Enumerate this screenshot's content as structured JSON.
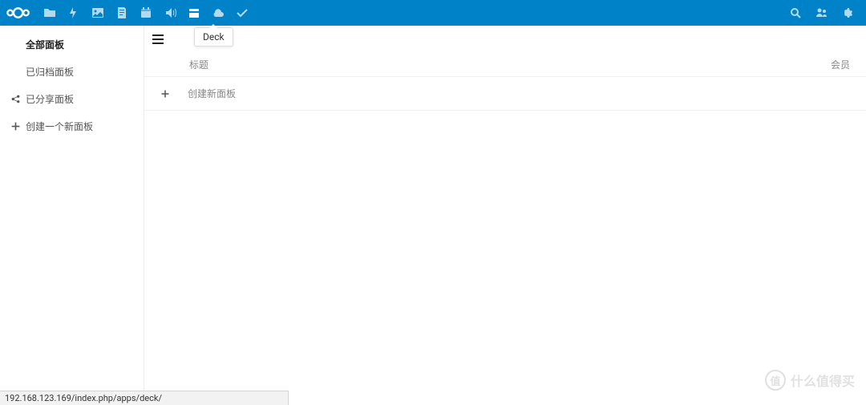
{
  "colors": {
    "brand": "#0082c9"
  },
  "tooltip": {
    "text": "Deck"
  },
  "topbar": {
    "apps": [
      {
        "name": "files-icon"
      },
      {
        "name": "activity-icon"
      },
      {
        "name": "gallery-icon"
      },
      {
        "name": "notes-icon"
      },
      {
        "name": "calendar-icon"
      },
      {
        "name": "audio-icon"
      },
      {
        "name": "deck-icon",
        "active": true
      },
      {
        "name": "cloud-icon"
      },
      {
        "name": "tasks-icon"
      }
    ],
    "right": [
      {
        "name": "search-icon"
      },
      {
        "name": "contacts-icon"
      },
      {
        "name": "settings-icon"
      }
    ]
  },
  "sidebar": {
    "items": [
      {
        "label": "全部面板",
        "name": "sidebar-item-all-boards",
        "active": true,
        "icon": null
      },
      {
        "label": "已归档面板",
        "name": "sidebar-item-archived",
        "icon": null
      },
      {
        "label": "已分享面板",
        "name": "sidebar-item-shared",
        "icon": "share"
      },
      {
        "label": "创建一个新面板",
        "name": "sidebar-item-create",
        "icon": "plus"
      }
    ]
  },
  "main": {
    "table": {
      "title_header": "标题",
      "member_header": "会员"
    },
    "create_row": {
      "label": "创建新面板"
    }
  },
  "statusbar": {
    "text": "192.168.123.169/index.php/apps/deck/"
  },
  "watermark": {
    "badge": "值",
    "text": "什么值得买"
  }
}
